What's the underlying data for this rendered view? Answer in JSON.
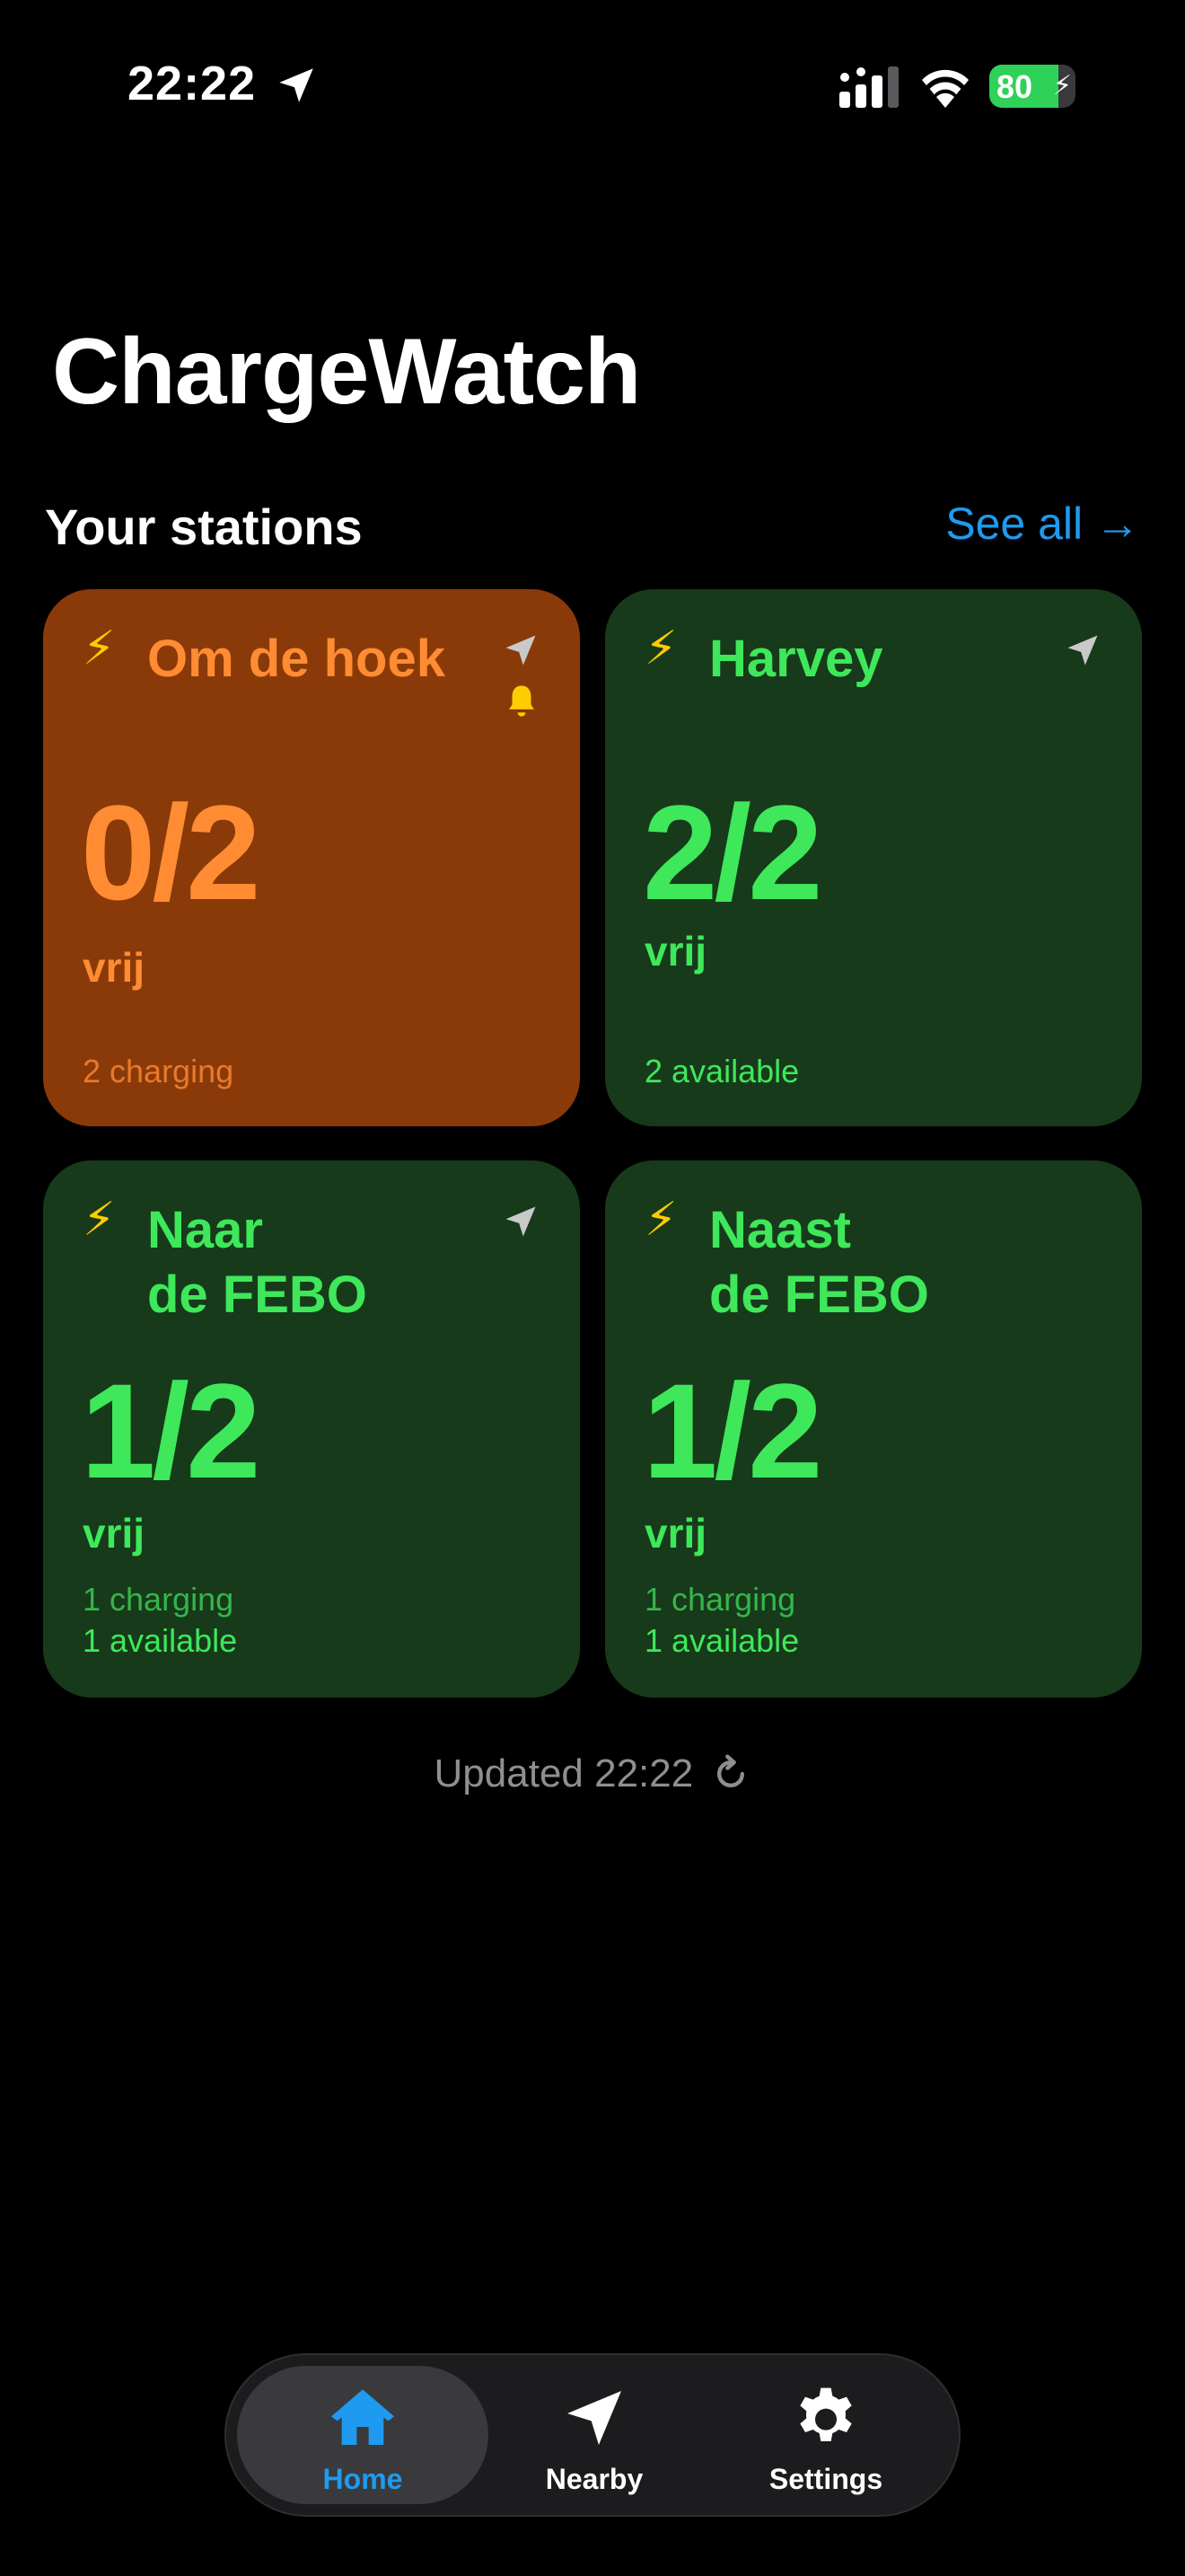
{
  "status_bar": {
    "time": "22:22",
    "battery_percent": "80",
    "battery_level": 0.8,
    "icons": [
      "location-arrow-icon",
      "cellular-signal-icon",
      "wifi-icon",
      "battery-icon"
    ]
  },
  "header": {
    "app_title": "ChargeWatch",
    "section_title": "Your stations",
    "see_all_label": "See all →"
  },
  "stations": [
    {
      "name_line1": "Om de hoek",
      "name_line2": "",
      "count": "0/2",
      "free_label": "vrij",
      "stat1": "2  charging",
      "stat2": "",
      "status": "occupied",
      "color": "#ff8c33",
      "bg": "#8a3a08",
      "has_bell": true
    },
    {
      "name_line1": "Harvey",
      "name_line2": "",
      "count": "2/2",
      "free_label": "vrij",
      "stat1": "2  available",
      "stat2": "",
      "status": "available",
      "color": "#3ee85a",
      "bg": "#173a1b",
      "has_bell": false
    },
    {
      "name_line1": "Naar",
      "name_line2": "de FEBO",
      "count": "1/2",
      "free_label": "vrij",
      "stat1": "1  charging",
      "stat2": "1  available",
      "status": "partial",
      "color": "#3ee85a",
      "bg": "#173a1b",
      "has_bell": false
    },
    {
      "name_line1": "Naast",
      "name_line2": "de FEBO",
      "count": "1/2",
      "free_label": "vrij",
      "stat1": "1  charging",
      "stat2": "1  available",
      "status": "partial",
      "color": "#3ee85a",
      "bg": "#173a1b",
      "has_bell": false
    }
  ],
  "updated_text": "Updated 22:22",
  "tabs": [
    {
      "label": "Home",
      "icon": "house-icon",
      "active": true
    },
    {
      "label": "Nearby",
      "icon": "location-arrow-icon",
      "active": false
    },
    {
      "label": "Settings",
      "icon": "gear-icon",
      "active": false
    }
  ],
  "colors": {
    "accent": "#1e9bf0",
    "bolt": "#ffcc00",
    "bell": "#ffcc00"
  }
}
